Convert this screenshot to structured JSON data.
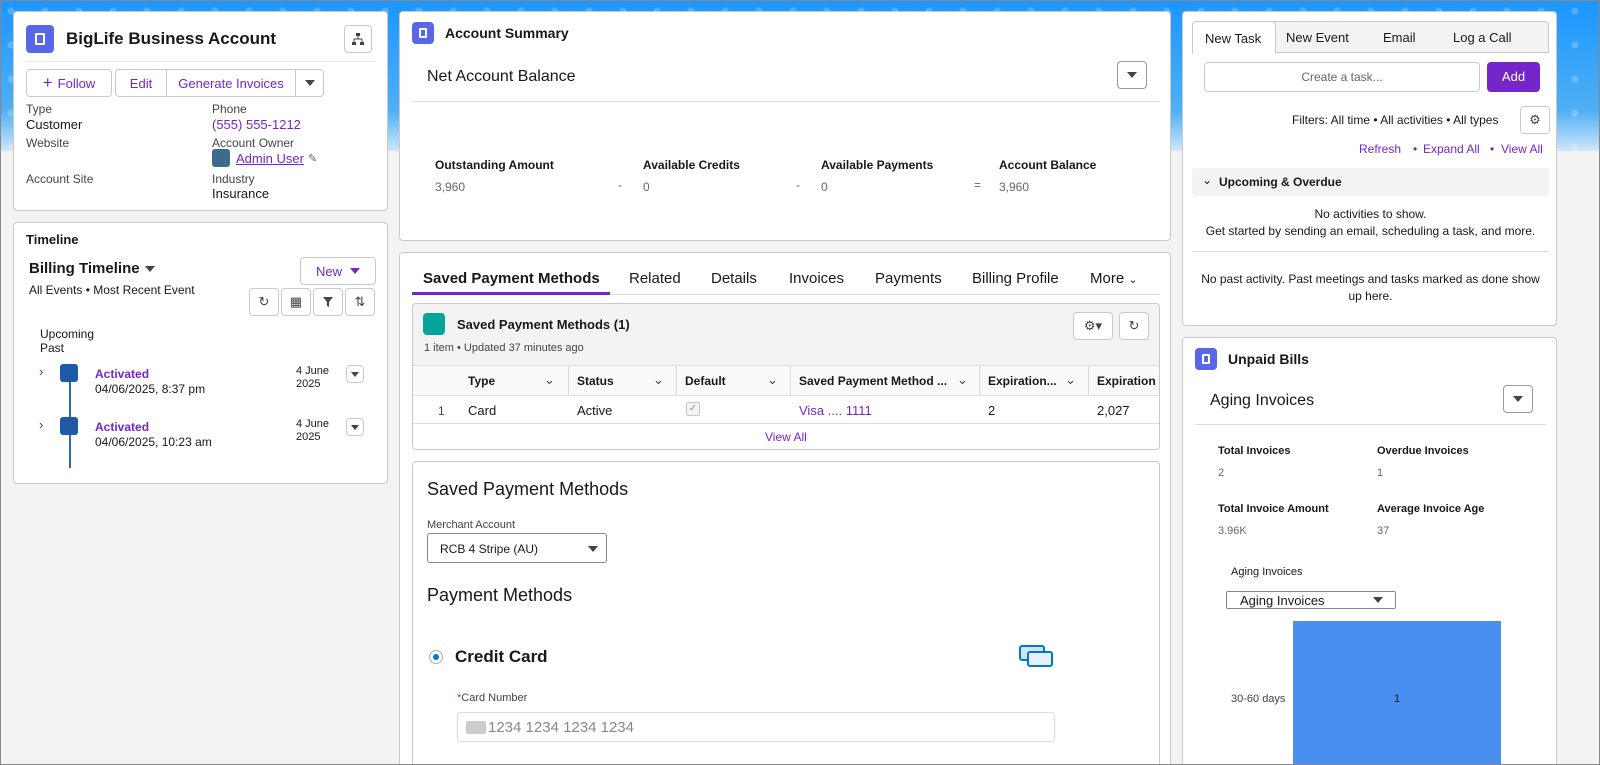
{
  "account": {
    "title": "BigLife Business Account",
    "follow": "Follow",
    "edit": "Edit",
    "generate": "Generate Invoices",
    "type_label": "Type",
    "type_value": "Customer",
    "phone_label": "Phone",
    "phone_value": "(555) 555-1212",
    "website_label": "Website",
    "owner_label": "Account Owner",
    "owner_value": "Admin User",
    "site_label": "Account Site",
    "industry_label": "Industry",
    "industry_value": "Insurance"
  },
  "timeline": {
    "header": "Timeline",
    "title": "Billing Timeline",
    "filter_text": "All Events • Most Recent Event",
    "new_label": "New",
    "upcoming": "Upcoming",
    "past": "Past",
    "items": [
      {
        "title": "Activated",
        "datetime": "04/06/2025, 8:37 pm",
        "date": "4 June",
        "year": "2025"
      },
      {
        "title": "Activated",
        "datetime": "04/06/2025, 10:23 am",
        "date": "4 June",
        "year": "2025"
      }
    ]
  },
  "summary": {
    "title": "Account Summary",
    "subtitle": "Net Account Balance",
    "cols": [
      {
        "label": "Outstanding Amount",
        "value": "3,960"
      },
      {
        "label": "Available Credits",
        "value": "0"
      },
      {
        "label": "Available Payments",
        "value": "0"
      },
      {
        "label": "Account Balance",
        "value": "3,960"
      }
    ],
    "ops": [
      "-",
      "-",
      "="
    ]
  },
  "tabs": [
    "Saved Payment Methods",
    "Related",
    "Details",
    "Invoices",
    "Payments",
    "Billing Profile",
    "More"
  ],
  "related": {
    "title": "Saved Payment Methods (1)",
    "meta": "1 item • Updated 37 minutes ago",
    "columns": [
      "Type",
      "Status",
      "Default",
      "Saved Payment Method ...",
      "Expiration...",
      "Expiration"
    ],
    "row": {
      "index": "1",
      "type": "Card",
      "status": "Active",
      "method": "Visa .... 1111",
      "exp_month": "2",
      "exp_year": "2,027"
    },
    "view_all": "View All"
  },
  "spm": {
    "title": "Saved Payment Methods",
    "merchant_label": "Merchant Account",
    "merchant_value": "RCB 4 Stripe (AU)",
    "payment_methods": "Payment Methods",
    "credit_card": "Credit Card",
    "card_label": "Card Number",
    "card_placeholder": "1234 1234 1234 1234",
    "required": "*"
  },
  "activity": {
    "tabs": [
      "New Task",
      "New Event",
      "Email",
      "Log a Call"
    ],
    "task_placeholder": "Create a task...",
    "add": "Add",
    "filters": "Filters: All time • All activities • All types",
    "refresh": "Refresh",
    "expand": "Expand All",
    "view_all": "View All",
    "upcoming": "Upcoming & Overdue",
    "no_activities": "No activities to show.",
    "get_started": "Get started by sending an email, scheduling a task, and more.",
    "no_past": "No past activity. Past meetings and tasks marked as done show up here."
  },
  "unpaid": {
    "title": "Unpaid Bills",
    "subtitle": "Aging Invoices",
    "stats": [
      {
        "label": "Total Invoices",
        "value": "2"
      },
      {
        "label": "Overdue Invoices",
        "value": "1"
      },
      {
        "label": "Total Invoice Amount",
        "value": "3.96K"
      },
      {
        "label": "Average Invoice Age",
        "value": "37"
      }
    ],
    "chart_label": "Aging Invoices",
    "select_value": "Aging Invoices"
  },
  "chart_data": {
    "type": "bar",
    "orientation": "horizontal",
    "categories": [
      "30-60 days"
    ],
    "values": [
      1
    ],
    "title": "",
    "bar_color": "#4a8ff0"
  },
  "colors": {
    "brand": "#7526c8",
    "accent": "#0176d3",
    "badge": "#5867e8",
    "green": "#06a59a"
  }
}
